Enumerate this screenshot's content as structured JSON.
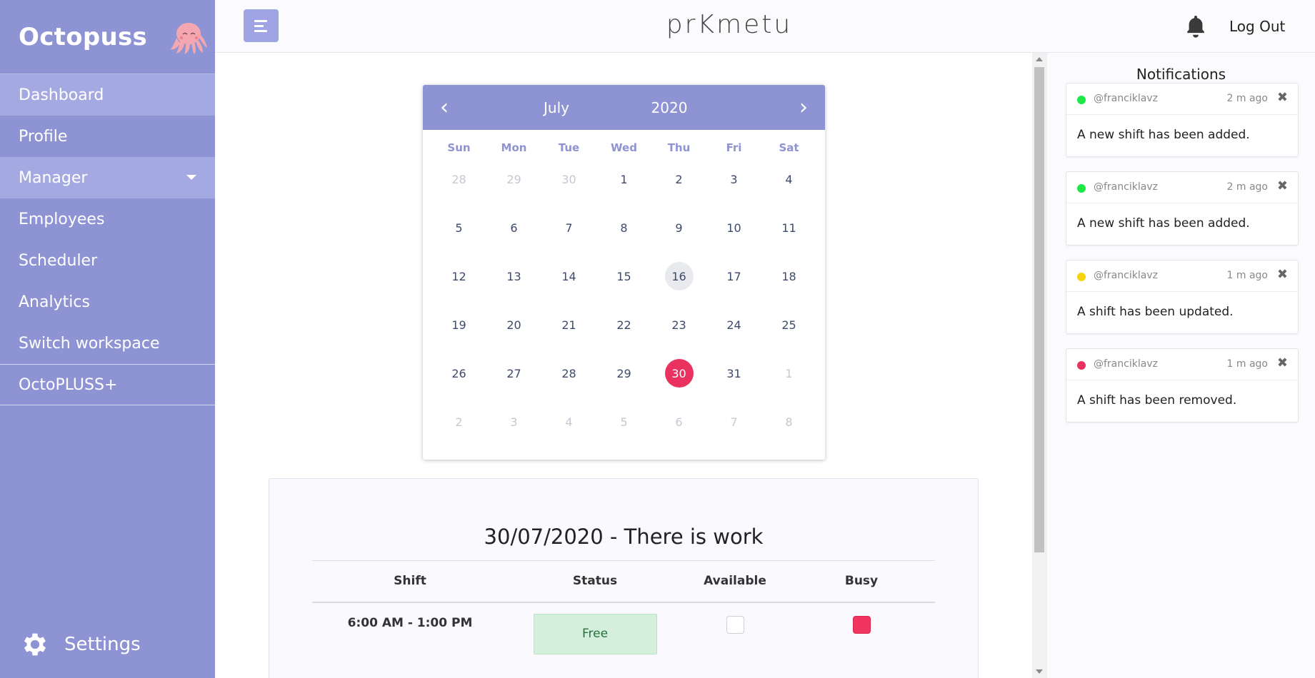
{
  "sidebar": {
    "brand": "Octopuss",
    "items": [
      {
        "label": "Dashboard"
      },
      {
        "label": "Profile"
      },
      {
        "label": "Manager"
      },
      {
        "label": "Employees"
      },
      {
        "label": "Scheduler"
      },
      {
        "label": "Analytics"
      },
      {
        "label": "Switch workspace"
      },
      {
        "label": "OctoPLUSS+"
      }
    ],
    "settings_label": "Settings",
    "colors": {
      "background": "#8e93d3",
      "active": "#a5a9e2"
    }
  },
  "topbar": {
    "title": "prKmetu",
    "logout_label": "Log Out",
    "icons": [
      "menu-icon",
      "bell-icon"
    ]
  },
  "calendar": {
    "month": "July",
    "year": "2020",
    "prev_label": "‹",
    "next_label": "›",
    "weekdays": [
      "Sun",
      "Mon",
      "Tue",
      "Wed",
      "Thu",
      "Fri",
      "Sat"
    ],
    "days": [
      "28",
      "29",
      "30",
      "1",
      "2",
      "3",
      "4",
      "5",
      "6",
      "7",
      "8",
      "9",
      "10",
      "11",
      "12",
      "13",
      "14",
      "15",
      "16",
      "17",
      "18",
      "19",
      "20",
      "21",
      "22",
      "23",
      "24",
      "25",
      "26",
      "27",
      "28",
      "29",
      "30",
      "31",
      "1",
      "2",
      "3",
      "4",
      "5",
      "6",
      "7",
      "8"
    ],
    "today": "16",
    "selected": "30",
    "selected_color": "#e9325f"
  },
  "day_panel": {
    "title": "30/07/2020 - There is work",
    "headers": [
      "Shift",
      "Status",
      "Available",
      "Busy"
    ],
    "rows": [
      {
        "shift": "6:00 AM - 1:00 PM",
        "status": "Free",
        "available": false,
        "busy": true
      }
    ]
  },
  "notifications": {
    "title": "Notifications",
    "items": [
      {
        "user": "@franciklavz",
        "time": "2 m ago",
        "message": "A new shift has been added.",
        "color": "#1ee848"
      },
      {
        "user": "@franciklavz",
        "time": "2 m ago",
        "message": "A new shift has been added.",
        "color": "#1ee848"
      },
      {
        "user": "@franciklavz",
        "time": "1 m ago",
        "message": "A shift has been updated.",
        "color": "#f4d40f"
      },
      {
        "user": "@franciklavz",
        "time": "1 m ago",
        "message": "A shift has been removed.",
        "color": "#e9325f"
      }
    ]
  }
}
